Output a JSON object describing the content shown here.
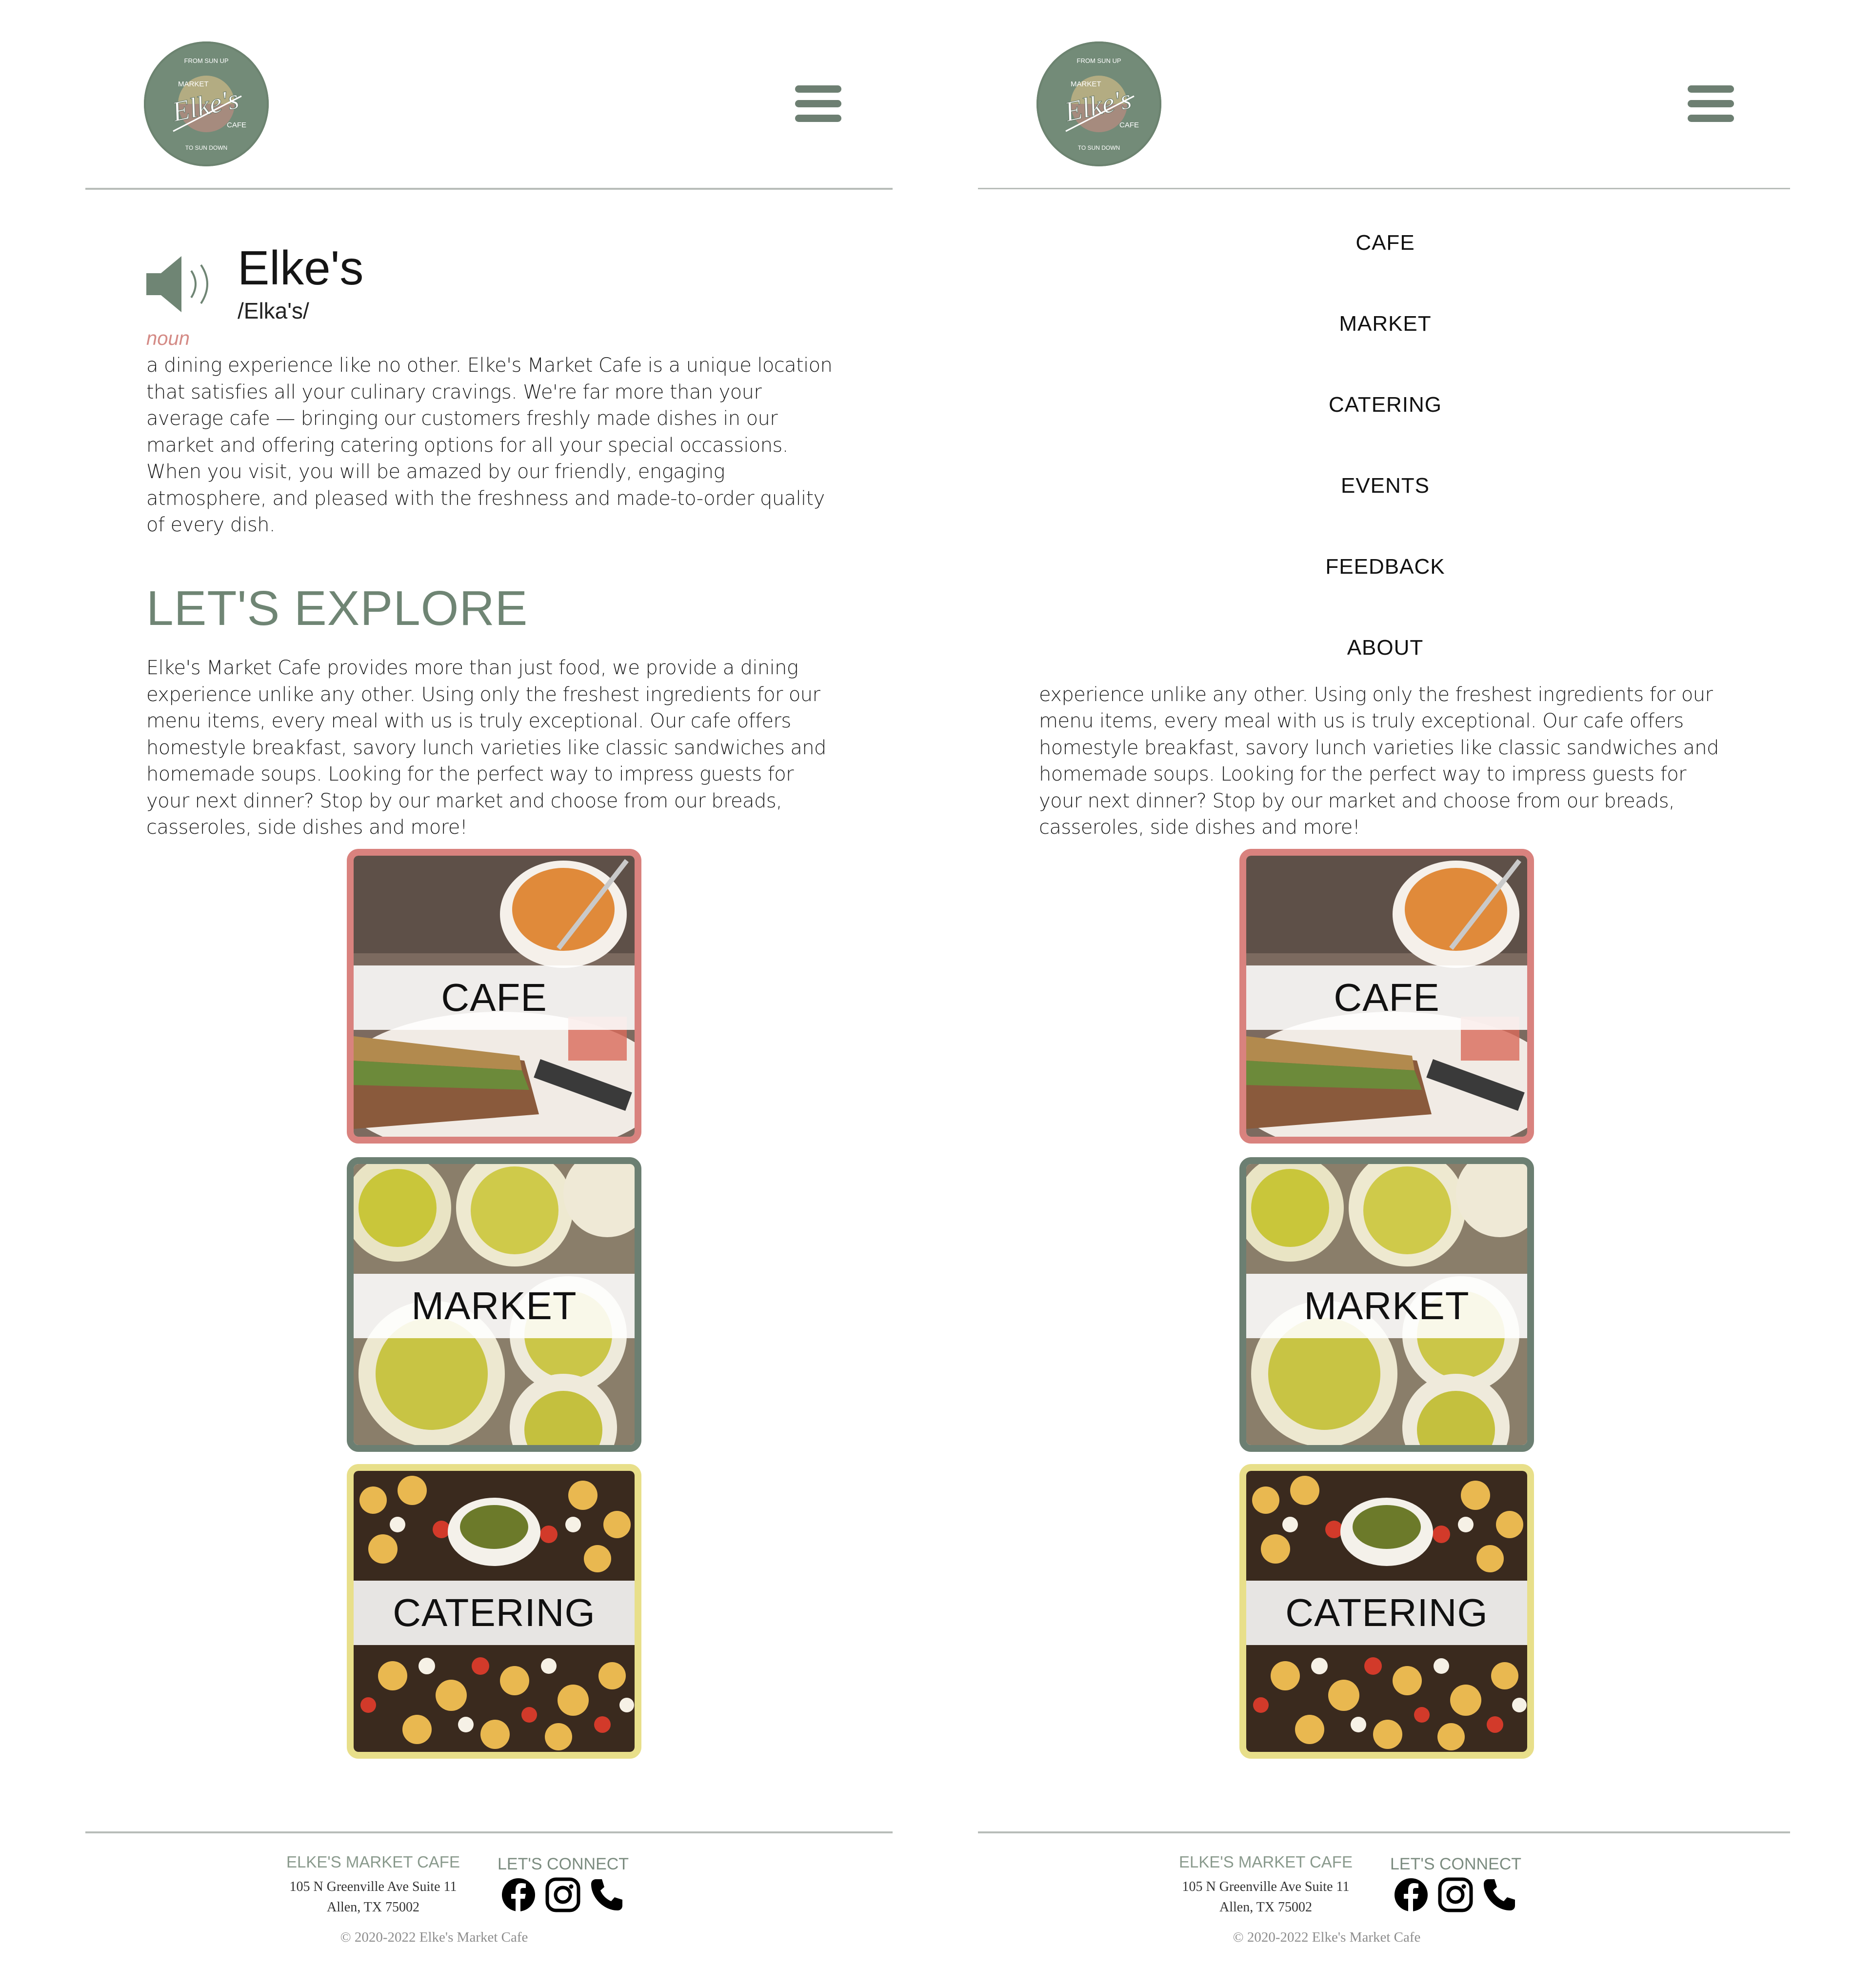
{
  "brand": {
    "logo_top": "FROM SUN UP",
    "logo_market": "MARKET",
    "logo_name": "Elke's",
    "logo_cafe": "CAFE",
    "logo_bottom": "TO SUN DOWN"
  },
  "definition": {
    "word": "Elke's",
    "phonetic": "/Elka's/",
    "part_of_speech": "noun",
    "text": "a dining experience like no other. Elke's Market Cafe is a unique location that satisfies all your culinary cravings. We're far more than your average cafe — bringing our customers freshly made dishes in our market and offering catering options for all your special occassions. When you visit, you will be amazed by our friendly, engaging atmosphere, and pleased with the freshness and made-to-order quality of every dish."
  },
  "explore": {
    "title": "LET'S EXPLORE",
    "text": "Elke's Market Cafe provides more than just food, we provide a dining experience unlike any other. Using only the freshest ingredients for our menu items, every meal with us is truly exceptional. Our cafe offers homestyle breakfast, savory lunch varieties like classic sandwiches and homemade soups. Looking for the perfect way to impress guests for your next dinner? Stop by our market and choose from our breads, casseroles, side dishes and more!"
  },
  "cards": [
    {
      "label": "CAFE",
      "border": "#d9827e"
    },
    {
      "label": "MARKET",
      "border": "#6c7f72"
    },
    {
      "label": "CATERING",
      "border": "#e8df8a"
    }
  ],
  "nav": {
    "items": [
      "CAFE",
      "MARKET",
      "CATERING",
      "EVENTS",
      "FEEDBACK",
      "ABOUT"
    ]
  },
  "footer": {
    "name": "ELKE'S MARKET CAFE",
    "address1": "105 N Greenville Ave Suite 11",
    "address2": "Allen, TX 75002",
    "connect": "LET'S CONNECT",
    "social_icons": [
      "facebook-icon",
      "instagram-icon",
      "phone-icon"
    ],
    "copyright": "© 2020-2022 Elke's Market Cafe"
  },
  "colors": {
    "sage": "#6f8574",
    "rose": "#d9827e",
    "butter": "#e8df8a",
    "noun": "#d48a85"
  }
}
